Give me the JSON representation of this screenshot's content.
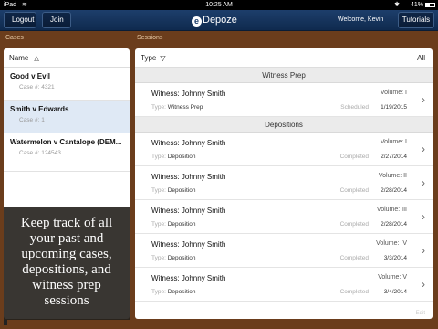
{
  "status_bar": {
    "carrier": "iPad",
    "time": "10:25 AM",
    "battery_pct": "41%",
    "icons": [
      "wifi-icon",
      "bluetooth-icon",
      "battery-icon"
    ]
  },
  "nav": {
    "logout_label": "Logout",
    "join_label": "Join",
    "logo_mark": "e",
    "logo_text": "Depoze",
    "welcome": "Welcome, Kevin",
    "tutorials_label": "Tutorials"
  },
  "cases": {
    "section_label": "Cases",
    "column_header": "Name",
    "items": [
      {
        "name": "Good v Evil",
        "number": "Case #: 4321",
        "selected": false
      },
      {
        "name": "Smith v Edwards",
        "number": "Case #: 1",
        "selected": true
      },
      {
        "name": "Watermelon v Cantalope (DEM...",
        "number": "Case #: 124543",
        "selected": false
      }
    ]
  },
  "promo": {
    "text": "Keep track of all your past and upcoming cases, depositions, and witness prep sessions"
  },
  "sessions": {
    "section_label": "Sessions",
    "filter_label": "Type",
    "filter_value": "All",
    "footer": "Edit",
    "type_prefix": "Type:",
    "groups": [
      {
        "title": "Witness Prep",
        "rows": [
          {
            "witness": "Witness: Johnny Smith",
            "volume": "Volume: I",
            "type": "Witness Prep",
            "status": "Scheduled",
            "date": "1/19/2015"
          }
        ]
      },
      {
        "title": "Depositions",
        "rows": [
          {
            "witness": "Witness: Johnny Smith",
            "volume": "Volume: I",
            "type": "Deposition",
            "status": "Completed",
            "date": "2/27/2014"
          },
          {
            "witness": "Witness: Johnny Smith",
            "volume": "Volume: II",
            "type": "Deposition",
            "status": "Completed",
            "date": "2/28/2014"
          },
          {
            "witness": "Witness: Johnny Smith",
            "volume": "Volume: III",
            "type": "Deposition",
            "status": "Completed",
            "date": "2/28/2014"
          },
          {
            "witness": "Witness: Johnny Smith",
            "volume": "Volume: IV",
            "type": "Deposition",
            "status": "Completed",
            "date": "3/3/2014"
          },
          {
            "witness": "Witness: Johnny Smith",
            "volume": "Volume: V",
            "type": "Deposition",
            "status": "Completed",
            "date": "3/4/2014"
          }
        ]
      }
    ]
  },
  "colors": {
    "nav_bg": "#1d3e6b",
    "selected_row": "#dfe9f5",
    "wood": "#6b3d1c"
  }
}
